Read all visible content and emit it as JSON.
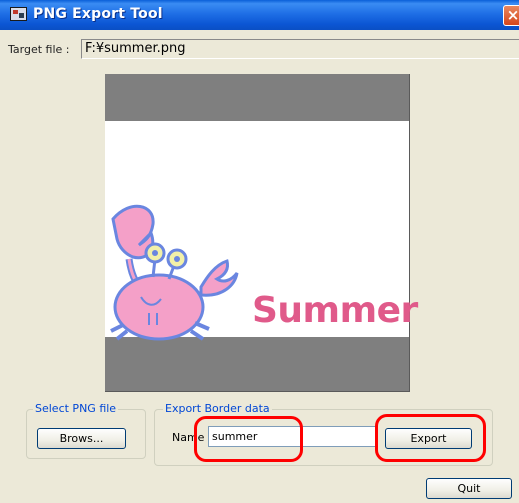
{
  "window": {
    "title": "PNG Export Tool",
    "close_glyph": "×"
  },
  "target": {
    "label": "Target file :",
    "value": "F:¥summer.png"
  },
  "preview": {
    "image_text": "Summer",
    "image_description_icons": [
      "crab-illustration"
    ]
  },
  "select_group": {
    "title": "Select PNG file",
    "browse_label": "Brows..."
  },
  "export_group": {
    "title": "Export Border data",
    "name_label": "Name",
    "name_value": "summer",
    "export_label": "Export"
  },
  "quit_label": "Quit",
  "colors": {
    "titlebar": "#0a5fd8",
    "window_bg": "#ece9d8",
    "highlight": "#ff0000",
    "preview_bg": "#7f7f7f",
    "summer_text": "#e05a8a"
  }
}
